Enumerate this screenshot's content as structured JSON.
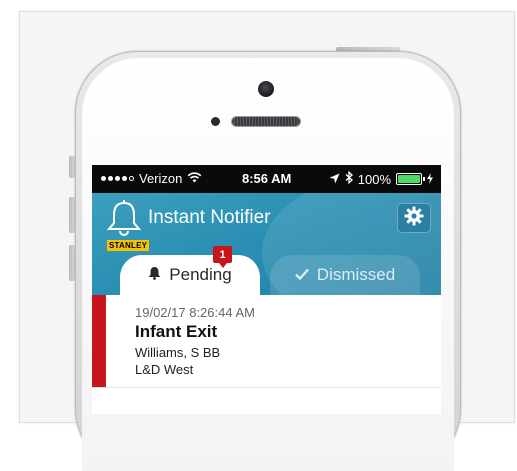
{
  "status_bar": {
    "carrier": "Verizon",
    "time": "8:56 AM",
    "battery": "100%"
  },
  "app": {
    "title": "Instant Notifier",
    "brand": "STANLEY"
  },
  "tabs": {
    "pending_label": "Pending",
    "pending_count": "1",
    "dismissed_label": "Dismissed"
  },
  "notifications": [
    {
      "timestamp": "19/02/17 8:26:44 AM",
      "title": "Infant Exit",
      "person": "Williams, S BB",
      "location": "L&D West"
    }
  ],
  "colors": {
    "header": "#2b8fb3",
    "alert": "#c4161c",
    "brand_yellow": "#f5c400",
    "battery": "#4cd964"
  }
}
